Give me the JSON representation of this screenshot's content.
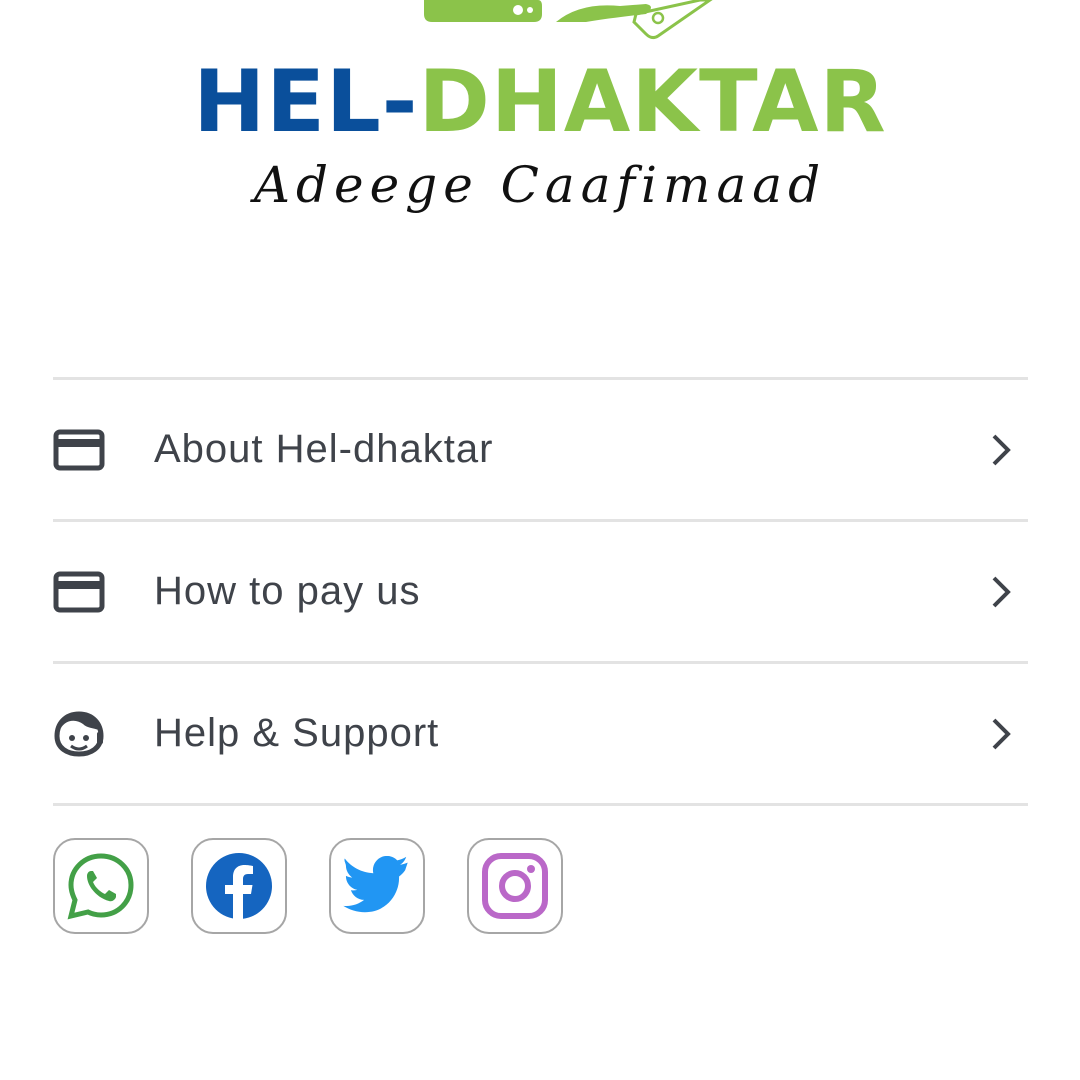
{
  "logo": {
    "title_part_a": "HEL-",
    "title_part_b": "DHAKTAR",
    "tagline": "Adeege Caafimaad",
    "colors": {
      "blue": "#0a4f9b",
      "green": "#8bc34a"
    }
  },
  "menu": {
    "items": [
      {
        "label": "About Hel-dhaktar",
        "icon": "credit-card-icon"
      },
      {
        "label": "How to pay us",
        "icon": "credit-card-icon"
      },
      {
        "label": "Help & Support",
        "icon": "support-agent-icon"
      }
    ],
    "text_color": "#3f434a",
    "divider_color": "#e3e3e3"
  },
  "social": {
    "items": [
      {
        "name": "whatsapp",
        "icon": "whatsapp-icon",
        "color": "#43a047"
      },
      {
        "name": "facebook",
        "icon": "facebook-icon",
        "color": "#1565c0"
      },
      {
        "name": "twitter",
        "icon": "twitter-icon",
        "color": "#2196f3"
      },
      {
        "name": "instagram",
        "icon": "instagram-icon",
        "color": "#ba68c8"
      }
    ]
  }
}
